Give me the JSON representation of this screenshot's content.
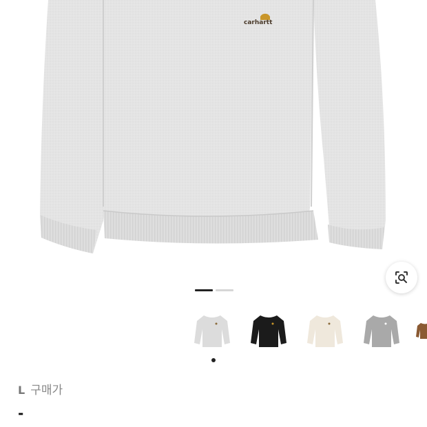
{
  "product": {
    "brand_logo": "carhartt",
    "image_alt": "heather grey crewneck sweatshirt",
    "colors": [
      "#e7e7e7",
      "#d7d7d7",
      "#cfcfcf"
    ]
  },
  "image_search": {
    "icon": "lens-search-icon"
  },
  "gallery": {
    "pages": 2,
    "current_page": 1
  },
  "variants": [
    {
      "name": "grey",
      "color": "#dcdcdc",
      "selected": true
    },
    {
      "name": "black",
      "color": "#1b1b1b",
      "selected": false
    },
    {
      "name": "natural",
      "color": "#efe8dc",
      "selected": false
    },
    {
      "name": "dark-grey",
      "color": "#a9a9a9",
      "selected": false
    },
    {
      "name": "brown",
      "color": "#8a5a33",
      "selected": false
    }
  ],
  "purchase": {
    "size": "L",
    "label": "구매가",
    "price": "-"
  }
}
